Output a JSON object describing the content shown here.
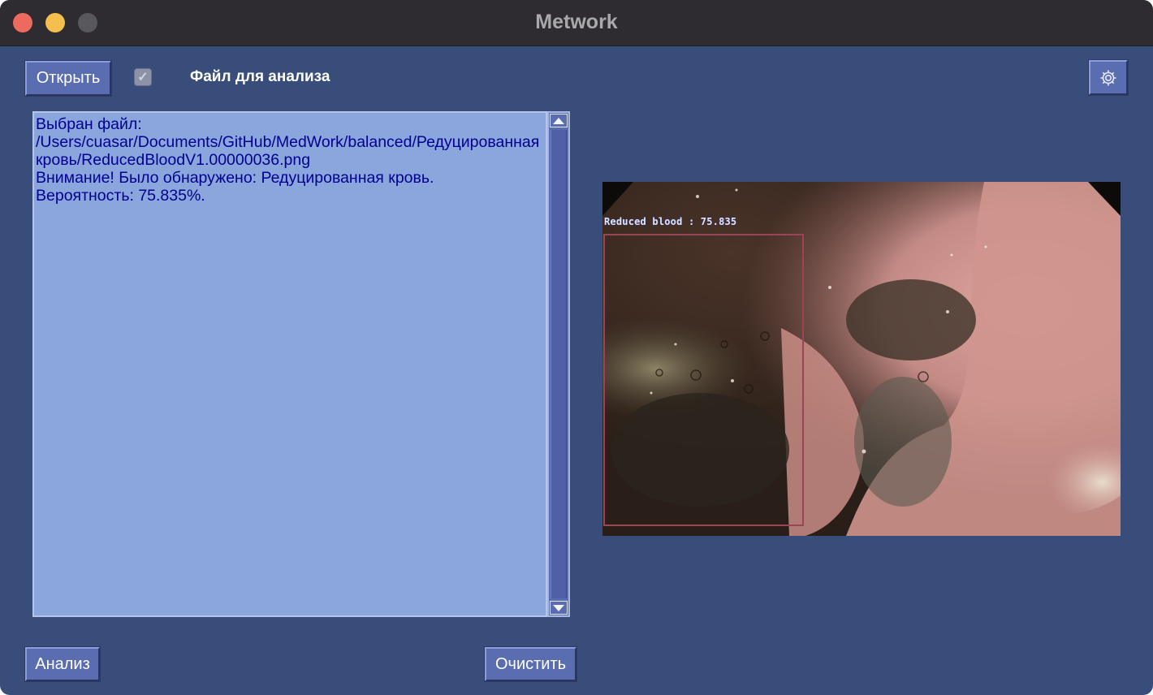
{
  "window": {
    "title": "Metwork"
  },
  "toolbar": {
    "open_label": "Открыть",
    "file_label": "Файл для анализа",
    "checkbox_checked": true,
    "checkbox_mark": "✓",
    "settings_icon": "gear-icon"
  },
  "output": {
    "text": "Выбран файл:\n/Users/cuasar/Documents/GitHub/MedWork/balanced/Редуцированная кровь/ReducedBloodV1.00000036.png\nВнимание! Было обнаружено: Редуцированная кровь.\nВероятность: 75.835%."
  },
  "image": {
    "detection_label": "Reduced blood : 75.835",
    "box_color": "#9a4455"
  },
  "actions": {
    "analyze_label": "Анализ",
    "clear_label": "Очистить"
  },
  "colors": {
    "window_bg": "#384d7a",
    "button_bg": "#5a6db0",
    "text_area_bg": "#8aa6dd",
    "text_color": "#000090"
  }
}
